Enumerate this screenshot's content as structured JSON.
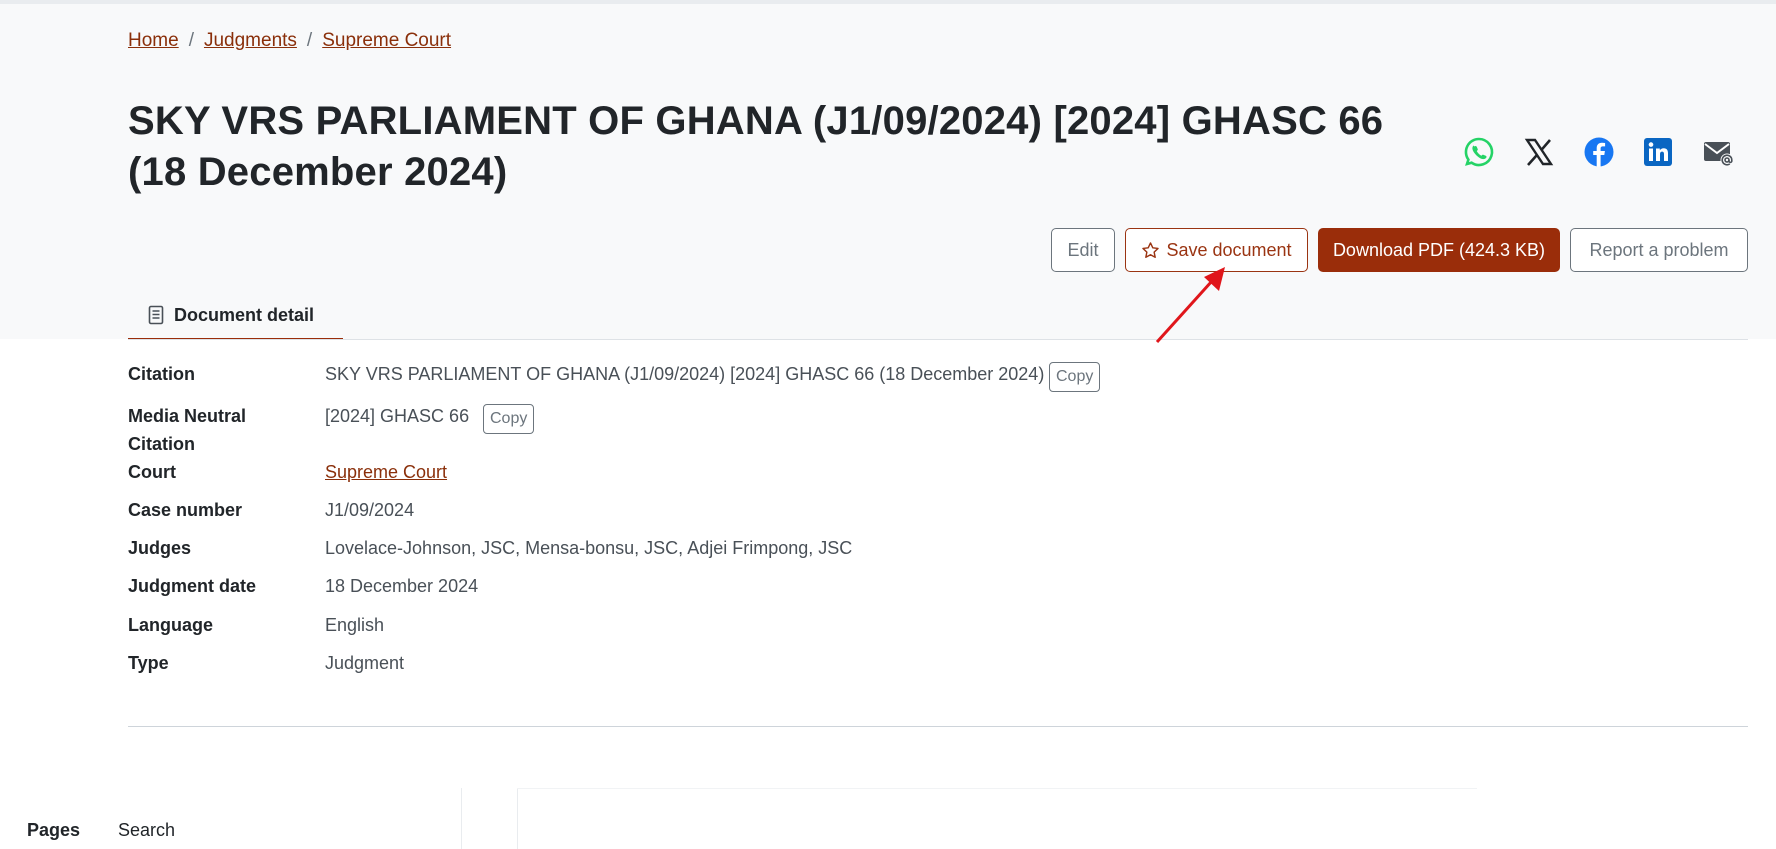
{
  "breadcrumb": {
    "home": "Home",
    "judgments": "Judgments",
    "court": "Supreme Court",
    "separator": "/"
  },
  "title": "SKY VRS PARLIAMENT OF GHANA (J1/09/2024) [2024] GHASC 66 (18 December 2024)",
  "share_icons": [
    "whatsapp-icon",
    "x-icon",
    "facebook-icon",
    "linkedin-icon",
    "email-icon"
  ],
  "actions": {
    "edit": "Edit",
    "save": "Save document",
    "download": "Download PDF (424.3 KB)",
    "report": "Report a problem"
  },
  "tab": {
    "label": "Document detail"
  },
  "details": {
    "citation_label": "Citation",
    "citation": "SKY VRS PARLIAMENT OF GHANA (J1/09/2024) [2024] GHASC 66 (18 December 2024)",
    "mnc_label_line1": "Media Neutral",
    "mnc_label_line2": "Citation",
    "mnc": "[2024] GHASC 66",
    "court_label": "Court",
    "court": "Supreme Court",
    "case_number_label": "Case number",
    "case_number": "J1/09/2024",
    "judges_label": "Judges",
    "judges": "Lovelace-Johnson, JSC, Mensa-bonsu, JSC, Adjei Frimpong, JSC",
    "judgment_date_label": "Judgment date",
    "judgment_date": "18 December 2024",
    "language_label": "Language",
    "language": "English",
    "type_label": "Type",
    "type": "Judgment"
  },
  "copy_label": "Copy",
  "bottom": {
    "pages": "Pages",
    "search": "Search"
  },
  "colors": {
    "brand": "#9a2d0a",
    "link": "#8a2f0a",
    "header_bg": "#f8f9fa",
    "annotation_arrow": "#e0161b",
    "whatsapp": "#25d366",
    "facebook": "#1877f2",
    "linkedin": "#0a66c2"
  }
}
